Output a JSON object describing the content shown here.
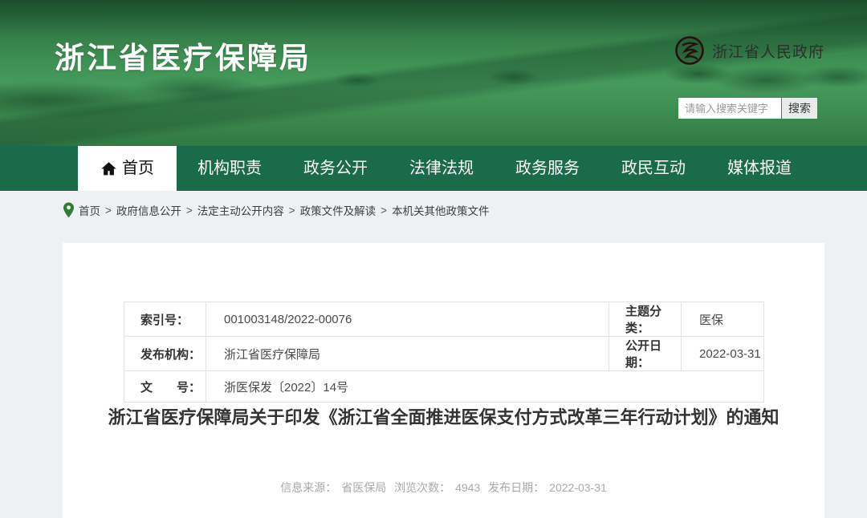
{
  "header": {
    "site_title": "浙江省医疗保障局",
    "gov_portal": "浙江省人民政府",
    "search": {
      "placeholder": "请输入搜索关键字",
      "button_label": "搜索"
    }
  },
  "nav": {
    "items": [
      {
        "label": "首页",
        "active": true
      },
      {
        "label": "机构职责",
        "active": false
      },
      {
        "label": "政务公开",
        "active": false
      },
      {
        "label": "法律法规",
        "active": false
      },
      {
        "label": "政务服务",
        "active": false
      },
      {
        "label": "政民互动",
        "active": false
      },
      {
        "label": "媒体报道",
        "active": false
      }
    ]
  },
  "breadcrumb": {
    "separator": ">",
    "items": [
      "首页",
      "政府信息公开",
      "法定主动公开内容",
      "政策文件及解读",
      "本机关其他政策文件"
    ]
  },
  "document": {
    "meta_table": {
      "row1": {
        "label1": "索引号：",
        "value1": "001003148/2022-00076",
        "label2": "主题分类：",
        "value2": "医保"
      },
      "row2": {
        "label1": "发布机构：",
        "value1": "浙江省医疗保障局",
        "label2": "公开日期：",
        "value2": "2022-03-31"
      },
      "row3": {
        "label1": "文　　号：",
        "value1": "浙医保发〔2022〕14号"
      }
    },
    "title": "浙江省医疗保障局关于印发《浙江省全面推进医保支付方式改革三年行动计划》的通知",
    "meta_line": {
      "source_label": "信息来源：",
      "source": "省医保局",
      "views_label": "浏览次数：",
      "views": "4943",
      "date_label": "发布日期：",
      "date": "2022-03-31"
    }
  },
  "colors": {
    "nav_green": "#1a6b4a",
    "header_green": "#3f9254",
    "pin_green": "#2e7d32",
    "page_background": "#eef0f4",
    "card_background": "#ffffff",
    "table_border": "#e2e2e2",
    "muted_text": "#a9a9a9"
  }
}
